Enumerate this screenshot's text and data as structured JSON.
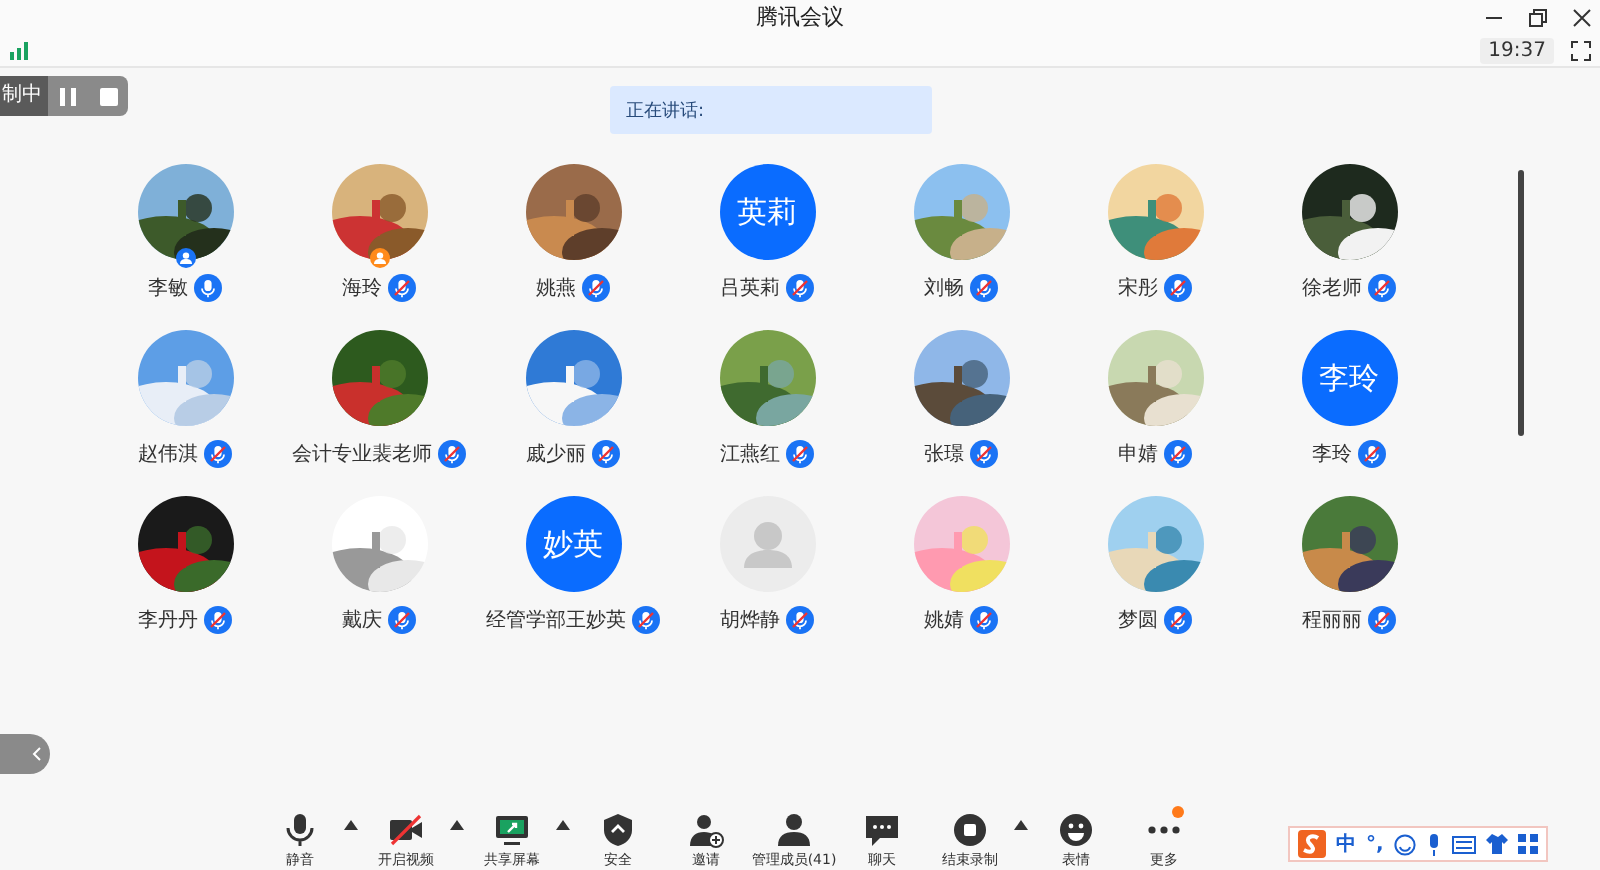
{
  "window": {
    "title": "腾讯会议"
  },
  "status": {
    "time": "19:37"
  },
  "recording": {
    "label": "制中"
  },
  "speaking": {
    "label": "正在讲话:"
  },
  "participants": [
    {
      "name": "李敏",
      "kind": "picture",
      "muted": false,
      "badge": {
        "color": "#1a73f5"
      }
    },
    {
      "name": "海玲",
      "kind": "picture",
      "muted": true,
      "badge": {
        "color": "#ff8a1a"
      }
    },
    {
      "name": "姚燕",
      "kind": "picture",
      "muted": true
    },
    {
      "name": "吕英莉",
      "kind": "initials",
      "initials": "英莉",
      "muted": true
    },
    {
      "name": "刘畅",
      "kind": "picture",
      "muted": true
    },
    {
      "name": "宋彤",
      "kind": "picture",
      "muted": true
    },
    {
      "name": "徐老师",
      "kind": "picture",
      "muted": true
    },
    {
      "name": "赵伟淇",
      "kind": "picture",
      "muted": true
    },
    {
      "name": "会计专业裴老师",
      "kind": "picture",
      "muted": true
    },
    {
      "name": "戚少丽",
      "kind": "picture",
      "muted": true
    },
    {
      "name": "江燕红",
      "kind": "picture",
      "muted": true
    },
    {
      "name": "张璟",
      "kind": "picture",
      "muted": true
    },
    {
      "name": "申婧",
      "kind": "picture",
      "muted": true
    },
    {
      "name": "李玲",
      "kind": "initials",
      "initials": "李玲",
      "muted": true
    },
    {
      "name": "李丹丹",
      "kind": "picture",
      "muted": true
    },
    {
      "name": "戴庆",
      "kind": "picture",
      "muted": true
    },
    {
      "name": "经管学部王妙英",
      "kind": "initials",
      "initials": "妙英",
      "muted": true
    },
    {
      "name": "胡烨静",
      "kind": "silhouette",
      "muted": true
    },
    {
      "name": "姚婧",
      "kind": "picture",
      "muted": true
    },
    {
      "name": "梦圆",
      "kind": "picture",
      "muted": true
    },
    {
      "name": "程丽丽",
      "kind": "picture",
      "muted": true
    }
  ],
  "toolbar": [
    {
      "kind": "mic",
      "label": "静音",
      "caret": true
    },
    {
      "kind": "camera-off",
      "label": "开启视频",
      "caret": true
    },
    {
      "kind": "share",
      "label": "共享屏幕",
      "caret": true
    },
    {
      "kind": "shield",
      "label": "安全",
      "caret": false
    },
    {
      "kind": "invite",
      "label": "邀请",
      "caret": false
    },
    {
      "kind": "members",
      "label": "管理成员(41)",
      "caret": false
    },
    {
      "kind": "chat",
      "label": "聊天",
      "caret": false
    },
    {
      "kind": "stop",
      "label": "结束录制",
      "caret": true
    },
    {
      "kind": "emoji",
      "label": "表情",
      "caret": false
    },
    {
      "kind": "more",
      "label": "更多",
      "caret": false,
      "badge": true
    }
  ],
  "ime": {
    "mode": "中",
    "punct": "°,"
  }
}
